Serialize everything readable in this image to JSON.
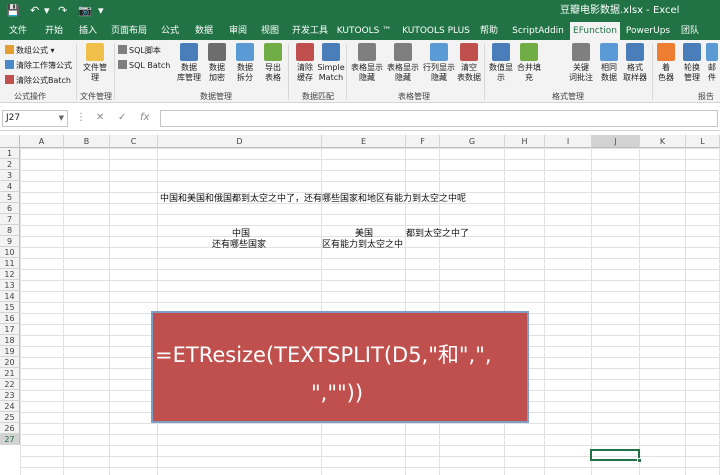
{
  "window": {
    "title": "豆瓣电影数据.xlsx  -  Excel"
  },
  "ribbon_tabs": [
    "文件",
    "开始",
    "插入",
    "页面布局",
    "公式",
    "数据",
    "审阅",
    "视图",
    "开发工具",
    "KUTOOLS ™",
    "KUTOOLS PLUS",
    "帮助",
    "ScriptAddin",
    "EFunction",
    "PowerUps",
    "团队"
  ],
  "active_tab": "EFunction",
  "ribbon": {
    "formula_ops": {
      "array_formula": "数组公式",
      "clear_sheet_formula": "清除工作簿公式",
      "clear_formula_batch": "清除公式Batch",
      "label": "公式操作"
    },
    "file_mgmt": {
      "file_manage": "文件管\n理",
      "label": "文件管理"
    },
    "data_mgmt": {
      "sql_script": "SQL脚本",
      "sql_batch": "SQL Batch",
      "buttons": [
        "数据\n库管理",
        "数据\n加密",
        "数据\n拆分",
        "导出\n表格"
      ],
      "label": "数据管理"
    },
    "data_match": {
      "buttons": [
        "清除\n缓存",
        "Simple\nMatch"
      ],
      "label": "数据匹配"
    },
    "table_mgmt": {
      "buttons": [
        "表格显示\n隐藏",
        "表格显示\n隐藏",
        "行列显示\n隐藏",
        "清空\n表数据"
      ],
      "label": "表格管理"
    },
    "format_mgmt": {
      "buttons": [
        "数值显\n示",
        "合并填\n充",
        "关键\n词批注",
        "相同\n数据",
        "格式\n取样器"
      ],
      "label": "格式管理"
    },
    "color": {
      "buttons": [
        "着\n色器",
        "轮换\n管理",
        "邮\n件"
      ],
      "label": "报告"
    }
  },
  "formula_bar": {
    "name_box": "J27",
    "cancel_glyph": "✕",
    "enter_glyph": "✓",
    "fx_glyph": "fx",
    "formula": ""
  },
  "columns": [
    "A",
    "B",
    "C",
    "D",
    "E",
    "F",
    "G",
    "H",
    "I",
    "J",
    "K",
    "L"
  ],
  "rows": [
    "1",
    "2",
    "3",
    "4",
    "5",
    "6",
    "7",
    "8",
    "9",
    "10",
    "11",
    "12",
    "13",
    "14",
    "15",
    "16",
    "17",
    "18",
    "19",
    "20",
    "21",
    "22",
    "23",
    "24",
    "25",
    "26",
    "27"
  ],
  "cells": {
    "D5": "中国和美国和俄国都到太空之中了，还有哪些国家和地区有能力到太空之中呢",
    "D8": "中国",
    "E8": "美国",
    "F8": "都到太空之中了",
    "D9": "还有哪些国家",
    "E9": "区有能力到太空之中"
  },
  "overlay": {
    "line1": "=ETResize(TEXTSPLIT(D5,\"和\",\",",
    "line2": "\",\"\"))",
    "background": "#c0504d"
  },
  "colors": {
    "excel_green": "#217346"
  }
}
